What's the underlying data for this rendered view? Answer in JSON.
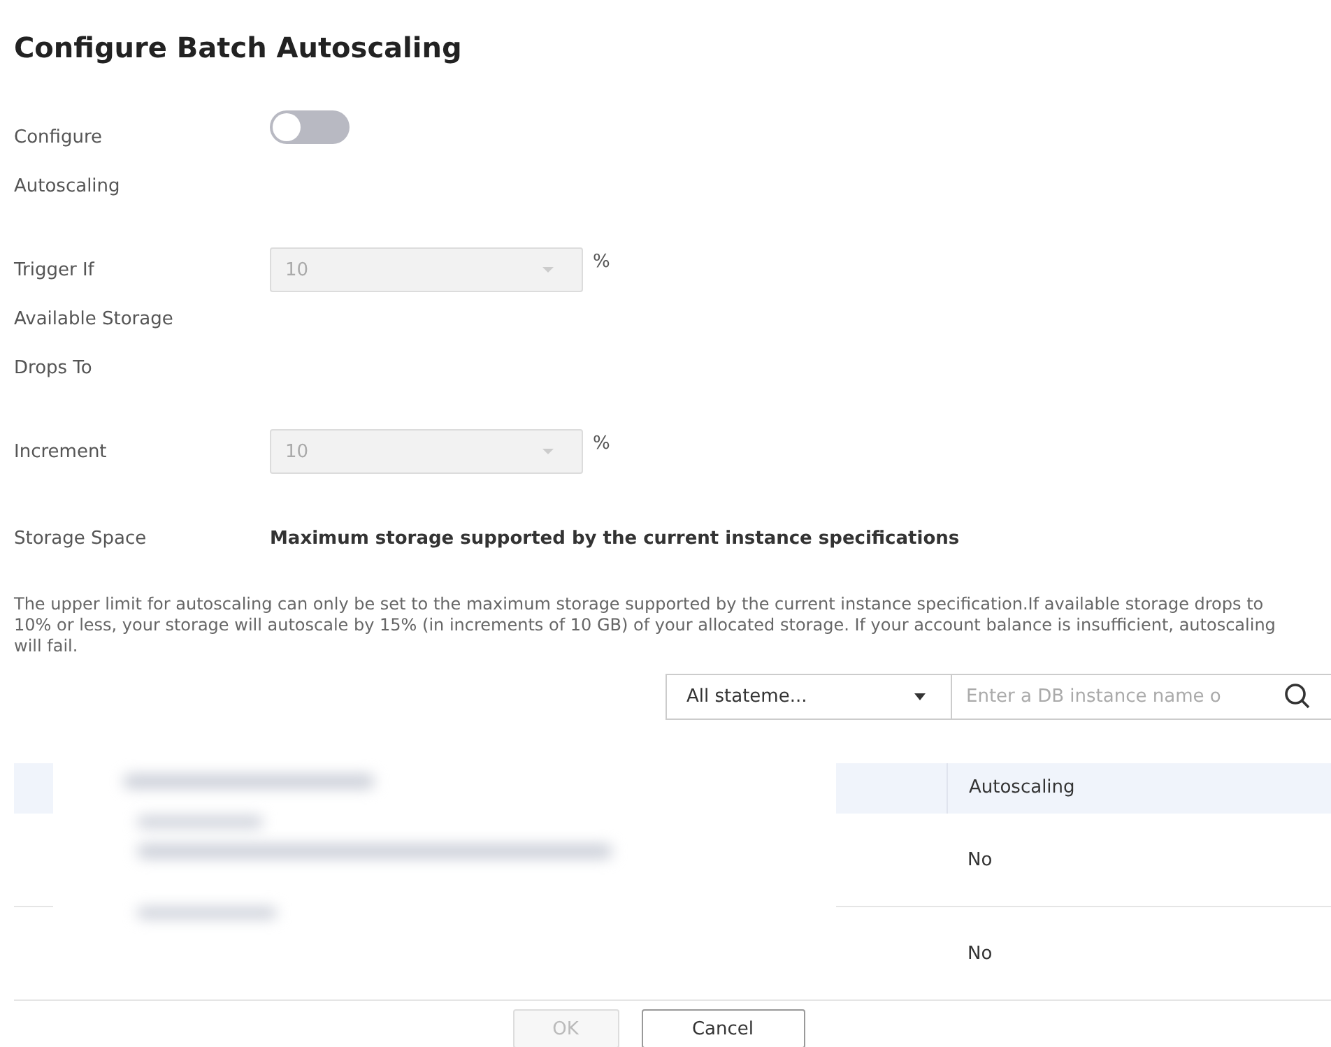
{
  "dialog": {
    "title": "Configure Batch Autoscaling"
  },
  "form": [
    {
      "kind": "toggle",
      "label": [
        "Configure",
        "Autoscaling"
      ],
      "on": false
    },
    {
      "kind": "select",
      "label": [
        "Trigger If",
        "Available Storage",
        "Drops To"
      ],
      "value": "10",
      "unit": "%",
      "disabled": true
    },
    {
      "kind": "select",
      "label": [
        "Increment"
      ],
      "value": "10",
      "unit": "%",
      "disabled": true
    },
    {
      "kind": "text",
      "label": [
        "Storage Space"
      ],
      "value": "Maximum storage supported by the current instance specifications"
    }
  ],
  "note": "The upper limit for autoscaling can only be set to the maximum storage supported by the current instance specification.If available storage drops to 10% or less, your storage will autoscale by 15% (in increments of 10 GB) of your allocated storage. If your account balance is insufficient, autoscaling will fail.",
  "filter": {
    "value": "All stateme...",
    "placeholder": "Enter a DB instance name o"
  },
  "table": {
    "columns": [
      "Autoscaling"
    ],
    "rows": [
      {
        "autoscaling": "No"
      },
      {
        "autoscaling": "No"
      }
    ]
  },
  "buttons": [
    {
      "label": "OK",
      "disabled": true
    },
    {
      "label": "Cancel",
      "disabled": false
    }
  ]
}
